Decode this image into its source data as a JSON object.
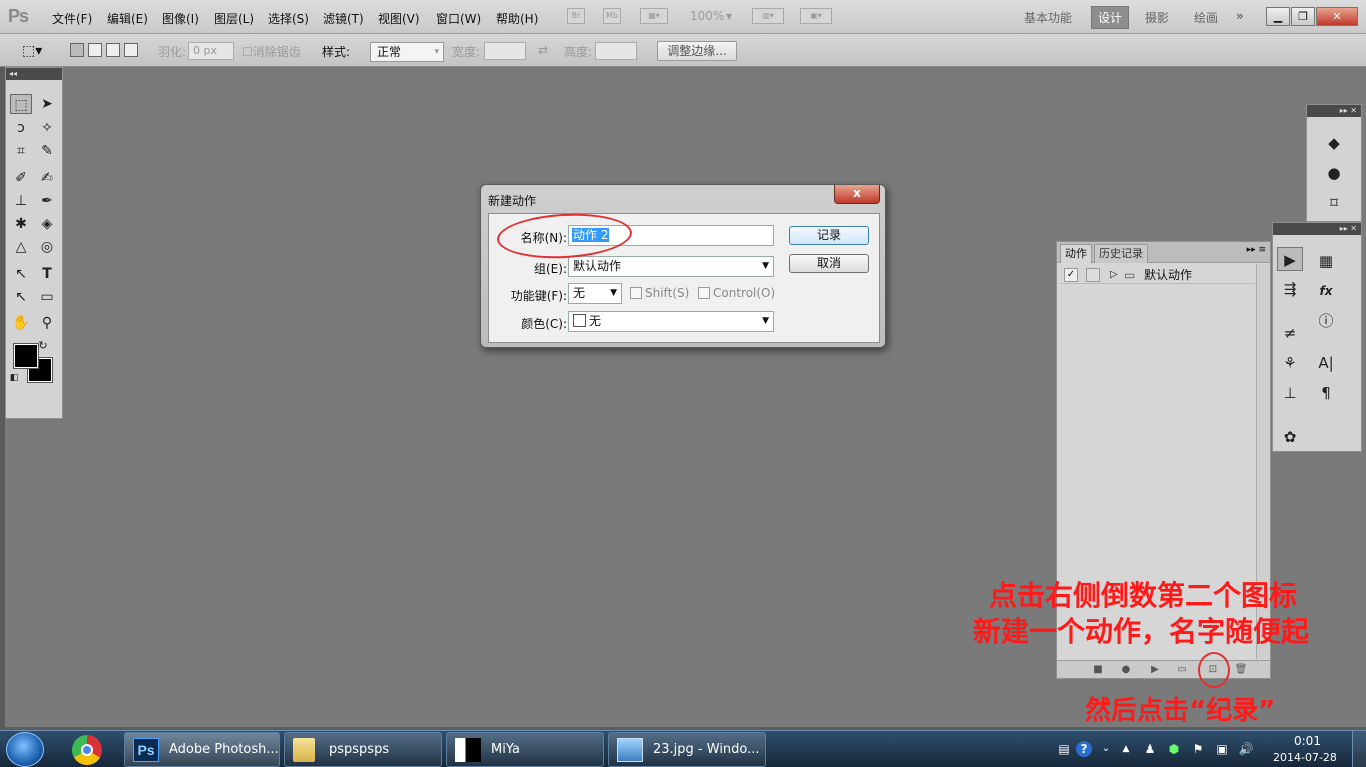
{
  "app": {
    "logo": "Ps"
  },
  "menu": {
    "items": [
      "文件(F)",
      "编辑(E)",
      "图像(I)",
      "图层(L)",
      "选择(S)",
      "滤镜(T)",
      "视图(V)",
      "窗口(W)",
      "帮助(H)"
    ],
    "zoom": "100%",
    "workspaces": [
      "基本功能",
      "设计",
      "摄影",
      "绘画"
    ],
    "active_workspace": "设计"
  },
  "options": {
    "feather_label": "羽化:",
    "feather_value": "0 px",
    "antialias_label": "消除锯齿",
    "style_label": "样式:",
    "style_value": "正常",
    "width_label": "宽度:",
    "height_label": "高度:",
    "refine_edge": "调整边缘..."
  },
  "dialog": {
    "title": "新建动作",
    "name_label": "名称(N):",
    "name_value": "动作 2",
    "set_label": "组(E):",
    "set_value": "默认动作",
    "fkey_label": "功能键(F):",
    "fkey_value": "无",
    "shift_label": "Shift(S)",
    "control_label": "Control(O)",
    "color_label": "颜色(C):",
    "color_value": "无",
    "record_button": "记录",
    "cancel_button": "取消",
    "close_button": "x"
  },
  "actions_panel": {
    "tabs": [
      "动作",
      "历史记录"
    ],
    "active_tab": "动作",
    "sets": [
      {
        "name": "默认动作",
        "checked": true
      }
    ]
  },
  "annotations": {
    "line1": "点击右侧倒数第二个图标",
    "line2": "新建一个动作，名字随便起",
    "line3": "然后点击“纪录”",
    "color": "#ff1a1a"
  },
  "taskbar": {
    "items": [
      "Adobe Photosh...",
      "pspspsps",
      "MiYa",
      "23.jpg - Windo..."
    ],
    "time": "0:01",
    "date": "2014-07-28"
  },
  "colors": {
    "canvas_bg": "#7a7a7a",
    "selection": "#3399ff",
    "foreground": "#000000",
    "background": "#000000"
  }
}
